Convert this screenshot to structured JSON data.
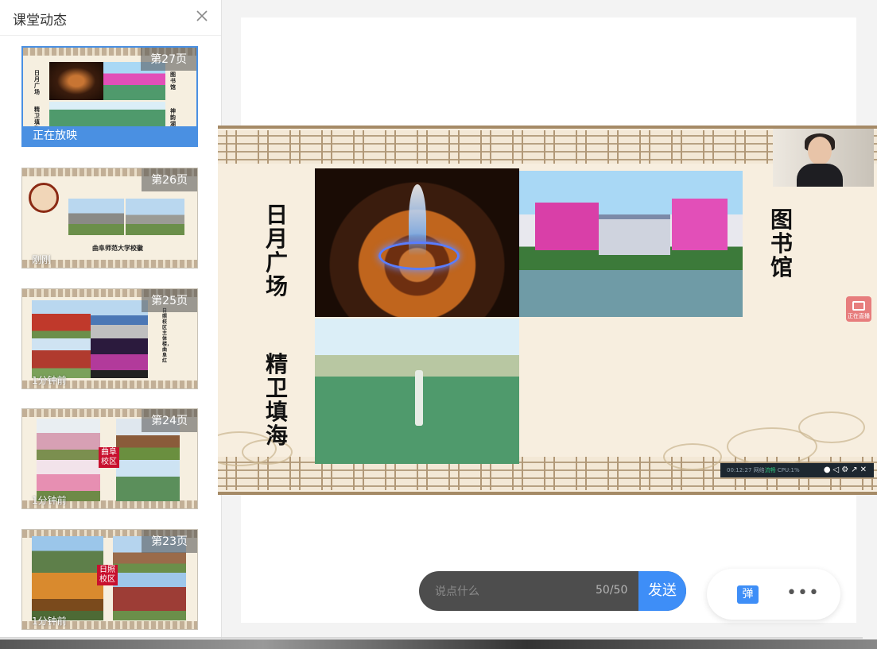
{
  "panel": {
    "title": "课堂动态",
    "thumbnails": [
      {
        "page": "第27页",
        "time": "",
        "status": "正在放映",
        "labels": [
          "日月广场",
          "图书馆",
          "精卫填海",
          "神韵湖"
        ]
      },
      {
        "page": "第26页",
        "time": "刚刚",
        "caption": "曲阜师范大学校徽"
      },
      {
        "page": "第25页",
        "time": "1分钟前",
        "caption": "日照校区主体楼，曲阜红"
      },
      {
        "page": "第24页",
        "time": "1分钟前",
        "badge": "曲阜校区"
      },
      {
        "page": "第23页",
        "time": "1分钟前",
        "badge": "日照校区"
      }
    ]
  },
  "slide": {
    "labels": {
      "sun_moon_square": "日月广场",
      "library": "图书馆",
      "jingwei": "精卫填海"
    },
    "recording_label": "正在直播",
    "status_bar": {
      "time": "00:12:27",
      "network_label": "网络",
      "network_value": "流畅",
      "cpu": "CPU:1%"
    }
  },
  "comment": {
    "placeholder": "说点什么",
    "count": "50/50",
    "send_label": "发送"
  },
  "actions": {
    "danmu_label": "弹",
    "more_label": "•••"
  },
  "colors": {
    "accent": "#3e8ef7",
    "active_border": "#4a90e2",
    "badge_red": "#c8102e"
  }
}
